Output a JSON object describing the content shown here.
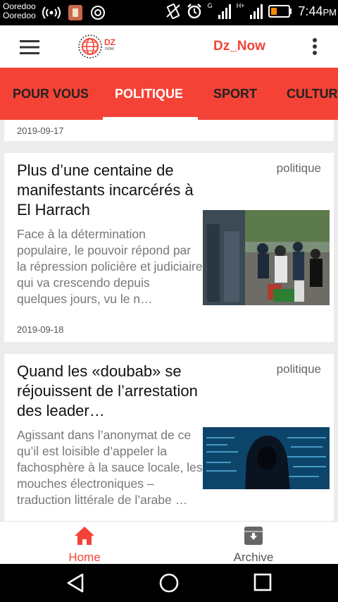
{
  "status_bar": {
    "carrier_1": "Ooredoo",
    "carrier_2": "Ooredoo",
    "network_1": "G",
    "network_2": "H+",
    "time": "7:44",
    "ampm": "PM"
  },
  "app_bar": {
    "title": "Dz_Now",
    "logo_text": "DZ",
    "logo_subtext": "now"
  },
  "tabs": [
    {
      "label": "POUR VOUS",
      "active": false
    },
    {
      "label": "POLITIQUE",
      "active": true
    },
    {
      "label": "SPORT",
      "active": false
    },
    {
      "label": "CULTURE",
      "active": false
    }
  ],
  "feed": {
    "previous_date": "2019-09-17",
    "articles": [
      {
        "title": "Plus d’une centaine de manifestants incarcérés à El Harrach",
        "category": "politique",
        "excerpt": "Face à la détermination populaire, le pouvoir répond par la répression policière et judiciaire qui va crescendo depuis quelques jours, vu le n…",
        "date": "2019-09-18",
        "thumbnail": "police-crowd-photo"
      },
      {
        "title": "Quand les «doubab» se réjouissent de l’arrestation des leader…",
        "category": "politique",
        "excerpt": "Agissant dans l’anonymat de ce qu’il est loisible d’appeler la fachosphère à la sauce locale, les mouches électroniques – traduction littérale de l’arabe …",
        "thumbnail": "hooded-hacker-photo"
      }
    ]
  },
  "bottom_nav": {
    "home_label": "Home",
    "archive_label": "Archive"
  },
  "colors": {
    "accent": "#f44336",
    "tab_text": "#222222",
    "active_tab_text": "#ffffff"
  }
}
